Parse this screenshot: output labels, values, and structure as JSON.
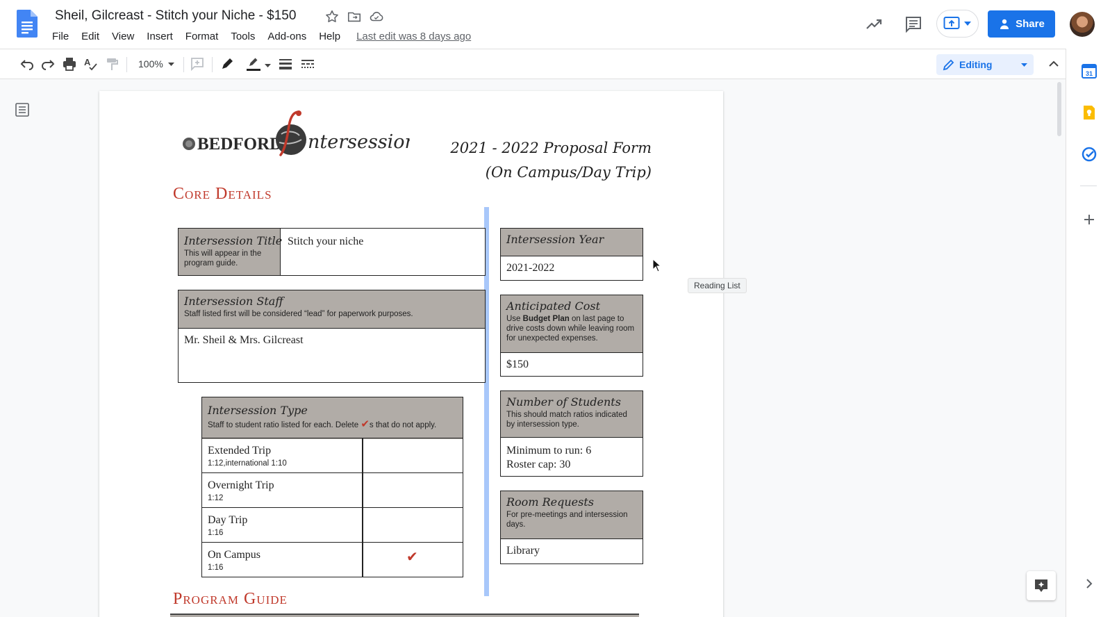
{
  "header": {
    "title": "Sheil, Gilcreast - Stitch your Niche - $150",
    "menu": [
      "File",
      "Edit",
      "View",
      "Insert",
      "Format",
      "Tools",
      "Add-ons",
      "Help"
    ],
    "last_edit": "Last edit was 8 days ago",
    "share_label": "Share",
    "icons": [
      "star-icon",
      "move-to-folder-icon",
      "cloud-status-icon",
      "activity-trend-icon",
      "comment-icon",
      "present-icon",
      "user-avatar"
    ]
  },
  "toolbar": {
    "zoom": "100%",
    "mode": "Editing",
    "icons": [
      "undo-icon",
      "redo-icon",
      "print-icon",
      "spellcheck-icon",
      "paint-format-icon",
      "add-comment-icon",
      "highlight-pen-icon",
      "line-color-icon",
      "line-weight-icon",
      "line-dash-icon",
      "edit-pencil-icon",
      "collapse-chevron-icon"
    ]
  },
  "workspace": {
    "reading_list_tooltip": "Reading List"
  },
  "document": {
    "logo_text": "BEDFORD",
    "logo_script": "ntersession",
    "proposal_line1": "2021 - 2022 Proposal Form",
    "proposal_line2": "(On Campus/Day Trip)",
    "section_core": "Core Details",
    "section_program": "Program Guide",
    "title_box": {
      "label": "Intersession Title",
      "note": "This will appear in the program guide.",
      "value": "Stitch your niche"
    },
    "staff_box": {
      "label": "Intersession Staff",
      "note": "Staff listed first will be considered “lead” for paperwork purposes.",
      "value": "Mr. Sheil & Mrs. Gilcreast"
    },
    "type_box": {
      "label": "Intersession Type",
      "note_before": "Staff to student ratio listed for each. Delete ",
      "note_check": "✔",
      "note_after": "s that do not apply.",
      "rows": [
        {
          "name": "Extended Trip",
          "ratio": "1:12,international 1:10",
          "check": ""
        },
        {
          "name": "Overnight Trip",
          "ratio": "1:12",
          "check": ""
        },
        {
          "name": "Day Trip",
          "ratio": "1:16",
          "check": ""
        },
        {
          "name": "On Campus",
          "ratio": "1:16",
          "check": "✔"
        }
      ]
    },
    "year_box": {
      "label": "Intersession Year",
      "value": "2021-2022"
    },
    "cost_box": {
      "label": "Anticipated Cost",
      "note_pre": "Use ",
      "note_bold": "Budget Plan",
      "note_post": " on last page to drive costs down while leaving room for unexpected expenses.",
      "value": "$150"
    },
    "students_box": {
      "label": "Number of Students",
      "note": "This should match ratios indicated by intersession type.",
      "value_line1": "Minimum to run: 6",
      "value_line2": "Roster cap: 30"
    },
    "room_box": {
      "label": "Room Requests",
      "note": "For pre-meetings and intersession days.",
      "value": "Library"
    }
  },
  "side_panel": {
    "icons": [
      "calendar-icon",
      "keep-icon",
      "tasks-icon",
      "add-addon-icon",
      "expand-panel-icon"
    ],
    "calendar_day": "31"
  }
}
